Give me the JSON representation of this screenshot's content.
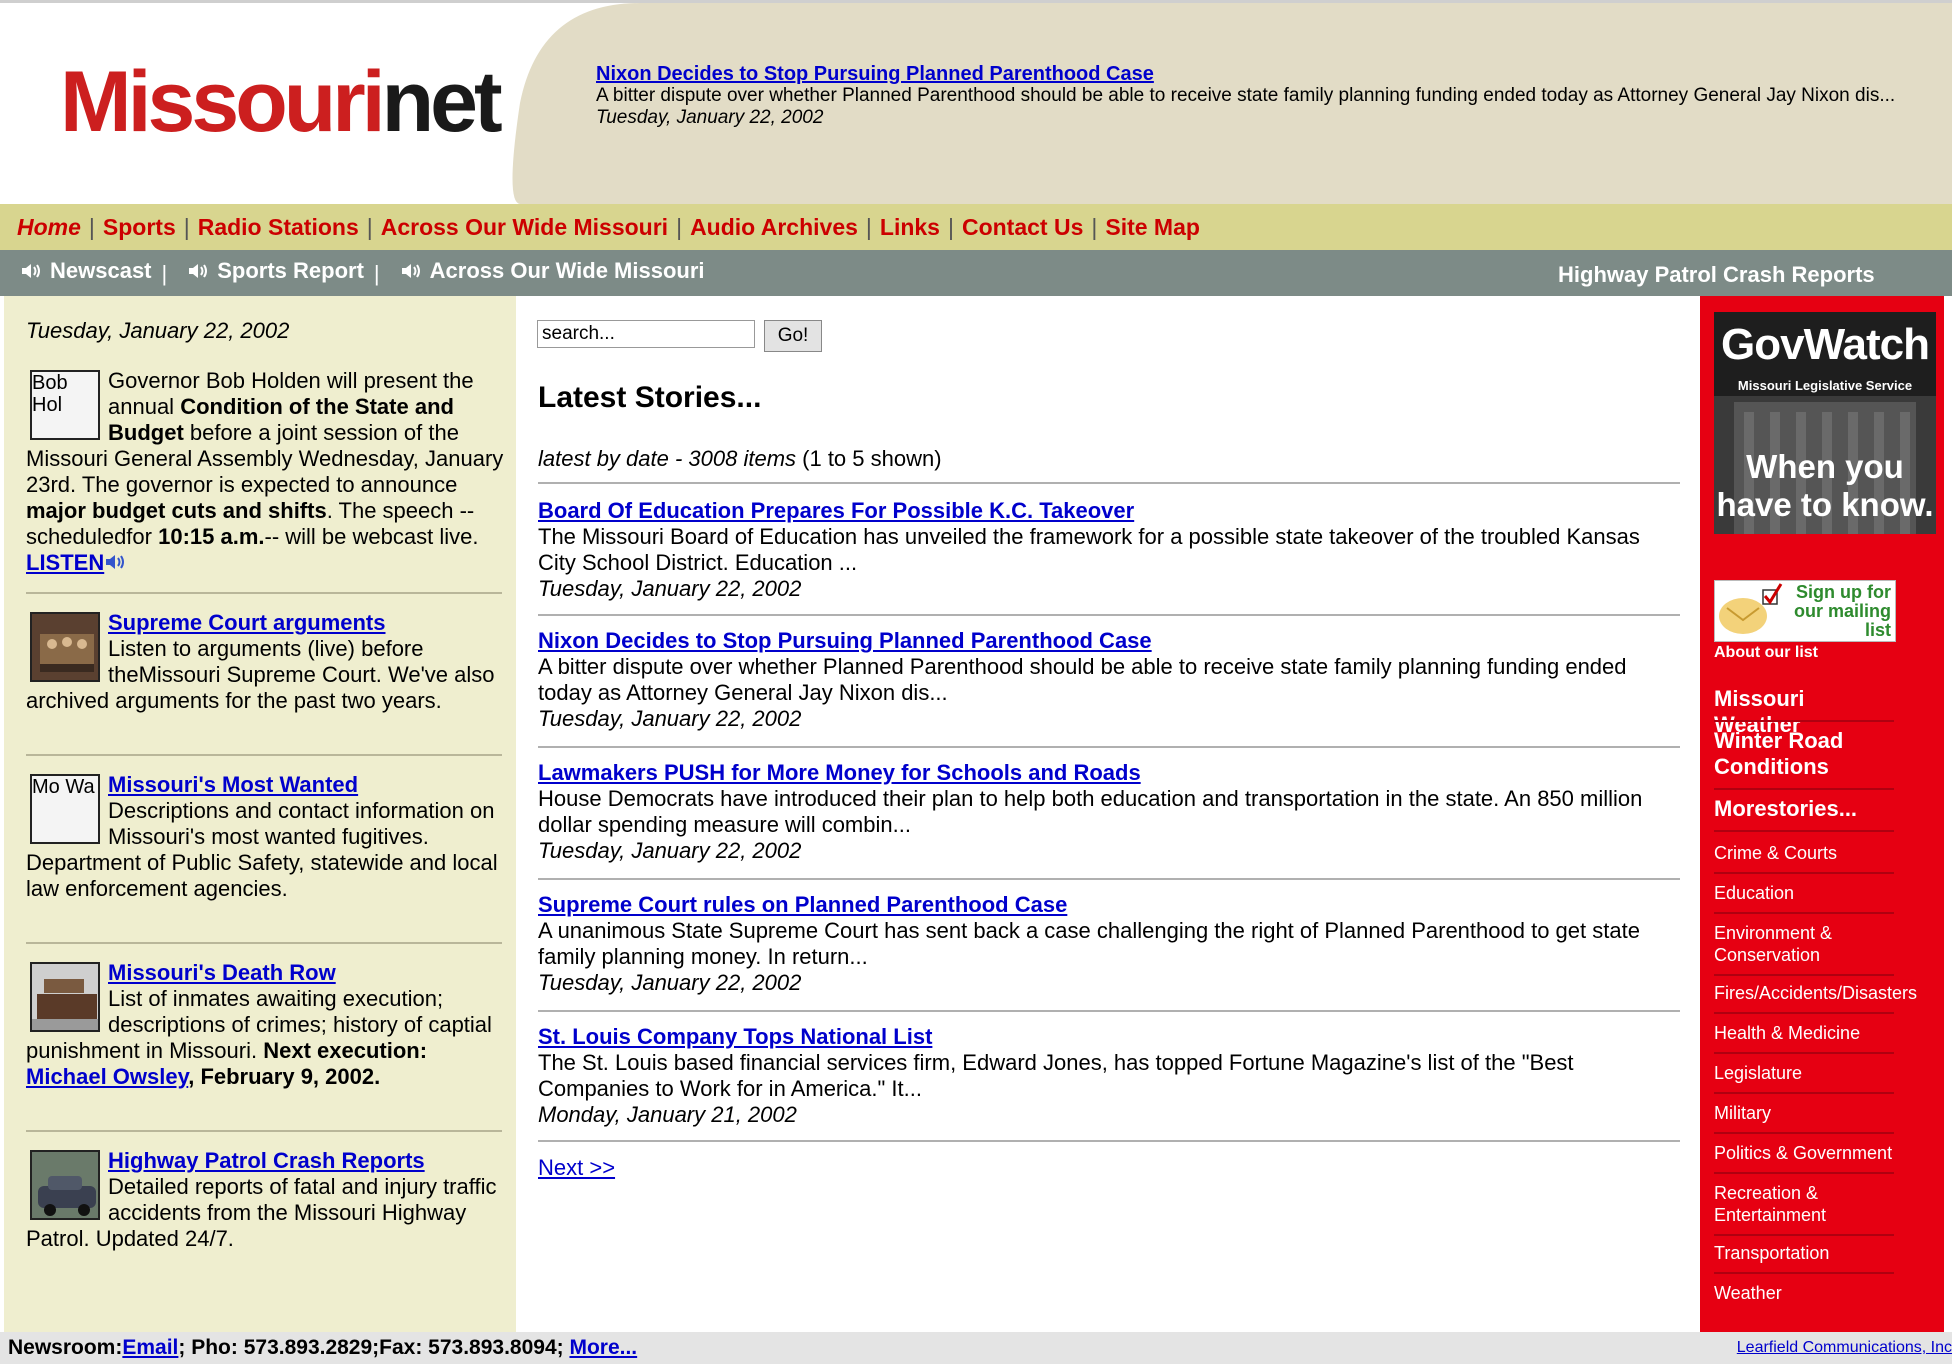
{
  "logo": {
    "part1": "Missouri",
    "part2": "net"
  },
  "headline": {
    "title": "Nixon Decides to Stop Pursuing Planned Parenthood Case",
    "summary": "A bitter dispute over whether Planned Parenthood should be able to receive state family planning funding ended today as Attorney General Jay Nixon dis...",
    "date": "Tuesday, January 22, 2002"
  },
  "topnav": [
    {
      "label": "Home"
    },
    {
      "label": "Sports"
    },
    {
      "label": "Radio Stations"
    },
    {
      "label": "Across Our Wide Missouri"
    },
    {
      "label": "Audio Archives"
    },
    {
      "label": "Links"
    },
    {
      "label": "Contact Us"
    },
    {
      "label": "Site Map"
    }
  ],
  "audionav": {
    "items": [
      {
        "label": "Newscast"
      },
      {
        "label": "Sports Report"
      },
      {
        "label": "Across Our Wide Missouri"
      }
    ],
    "separator": "|",
    "crash_reports": "Highway Patrol Crash Reports"
  },
  "left": {
    "date": "Tuesday, January 22, 2002",
    "holden": {
      "img_alt": "Bob Hol",
      "t1": "Governor Bob Holden will present the annual ",
      "b1": "Condition of the State and Budget",
      "t2": " before a joint session of the Missouri General Assembly Wednesday, January 23rd. The governor is expected to announce ",
      "b2": "major budget cuts and shifts",
      "t3": ". The speech -- scheduledfor ",
      "b3": "10:15 a.m.",
      "t4": "-- will be webcast live. ",
      "listen": "LISTEN"
    },
    "court": {
      "title": "Supreme Court arguments",
      "desc": "Listen to arguments (live) before theMissouri Supreme Court. We've also archived arguments for the past two years."
    },
    "wanted": {
      "img_alt": "Mo Wa",
      "title": "Missouri's Most Wanted",
      "desc": "Descriptions and contact information on Missouri's most wanted fugitives. Department of Public Safety, statewide and local law enforcement agencies."
    },
    "deathrow": {
      "title": "Missouri's Death Row",
      "desc": "List of inmates awaiting execution; descriptions of crimes; history of captial punishment in Missouri. ",
      "next_label": "Next execution: ",
      "next_name": "Michael Owsley",
      "next_date": ", February 9, 2002."
    },
    "crash": {
      "title": "Highway Patrol Crash Reports",
      "desc": "Detailed reports of fatal and injury traffic accidents from the Missouri Highway Patrol. Updated 24/7."
    }
  },
  "search": {
    "value": "search...",
    "button": "Go!"
  },
  "latest": {
    "title": "Latest Stories...",
    "meta_italic": "latest by date - 3008 items",
    "meta_count": " (1 to 5 shown)",
    "stories": [
      {
        "title": "Board Of Education Prepares For Possible K.C. Takeover",
        "summary": "The Missouri Board of Education has unveiled the framework for a possible state takeover of the troubled Kansas City School District. Education ...",
        "date": "Tuesday, January 22, 2002"
      },
      {
        "title": "Nixon Decides to Stop Pursuing Planned Parenthood Case",
        "summary": "A bitter dispute over whether Planned Parenthood should be able to receive state family planning funding ended today as Attorney General Jay Nixon dis...",
        "date": "Tuesday, January 22, 2002"
      },
      {
        "title": "Lawmakers PUSH for More Money for Schools and Roads",
        "summary": "House Democrats have introduced their plan to help both education and transportation in the state. An 850 million dollar spending measure will combin...",
        "date": "Tuesday, January 22, 2002"
      },
      {
        "title": "Supreme Court rules on Planned Parenthood Case",
        "summary": "A unanimous State Supreme Court has sent back a case challenging the right of Planned Parenthood to get state family planning money. In return...",
        "date": "Tuesday, January 22, 2002"
      },
      {
        "title": "St. Louis Company Tops National List",
        "summary": "The St. Louis based financial services firm, Edward Jones, has topped Fortune Magazine's list of the \"Best Companies to Work for in America.\" It...",
        "date": "Monday, January 21, 2002"
      }
    ],
    "next": "Next >>"
  },
  "right": {
    "govwatch": {
      "title": "GovWatch",
      "subtitle": "Missouri Legislative Service",
      "tagline": "When you have to know."
    },
    "mailing": "Sign up for our mailing list",
    "about": "About our list",
    "weather": "Missouri Weather",
    "road": "Winter Road Conditions",
    "more": "Morestories...",
    "categories": [
      "Crime & Courts",
      "Education",
      "Environment & Conservation",
      "Fires/Accidents/Disasters",
      "Health & Medicine",
      "Legislature",
      "Military",
      "Politics & Government",
      "Recreation & Entertainment",
      "Transportation",
      "Weather"
    ]
  },
  "footer": {
    "label": "Newsroom:",
    "email": "Email",
    "contact": "; Pho: 573.893.2829;Fax: 573.893.8094; ",
    "more": "More...",
    "copyright": "Learfield Communications, Inc"
  }
}
